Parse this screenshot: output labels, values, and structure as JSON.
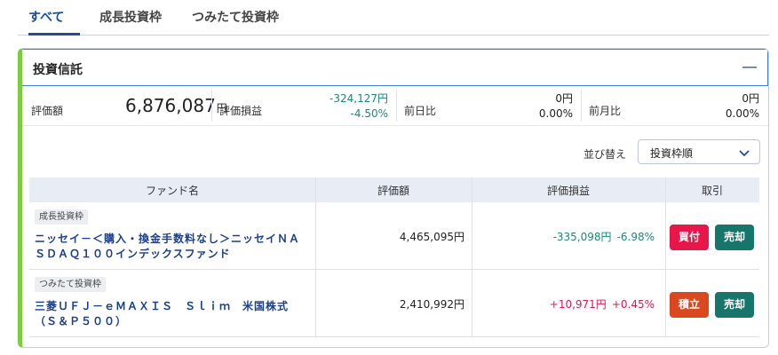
{
  "tabs": [
    {
      "label": "すべて",
      "active": true
    },
    {
      "label": "成長投資枠",
      "active": false
    },
    {
      "label": "つみたて投資枠",
      "active": false
    }
  ],
  "card": {
    "title": "投資信託",
    "collapse_symbol": "—",
    "summary": {
      "valuation_label": "評価額",
      "valuation_value": "6,876,087",
      "yen": "円",
      "pl_label": "評価損益",
      "pl_value": "-324,127円",
      "pl_pct": "-4.50%",
      "prev_day_label": "前日比",
      "prev_day_value": "0円",
      "prev_day_pct": "0.00%",
      "prev_month_label": "前月比",
      "prev_month_value": "0円",
      "prev_month_pct": "0.00%"
    },
    "sort": {
      "label": "並び替え",
      "value": "投資枠順"
    },
    "table": {
      "headers": [
        "ファンド名",
        "評価額",
        "評価損益",
        "取引"
      ],
      "rows": [
        {
          "badge": "成長投資枠",
          "fund": "ニッセイ－＜購入・換金手数料なし＞ニッセイＮＡＳＤＡＱ１００インデックスファンド",
          "amount": "4,465,095円",
          "pl_value": "-335,098円",
          "pl_pct": "-6.98%",
          "buttons": [
            "買付",
            "売却"
          ]
        },
        {
          "badge": "つみたて投資枠",
          "fund": "三菱ＵＦＪ－ｅＭＡＸＩＳ　Ｓｌｉｍ　米国株式（Ｓ＆Ｐ５００）",
          "amount": "2,410,992円",
          "pl_value": "+10,971円",
          "pl_pct": "+0.45%",
          "buttons": [
            "積立",
            "売却"
          ]
        }
      ]
    }
  },
  "colors": {
    "accent": "#1a4fa0",
    "left_border": "#7ccd3d",
    "negative": "#1a8a7a",
    "positive": "#e8174a",
    "buy": "#e8174a",
    "sell": "#16766b",
    "accumulate": "#d9481f"
  },
  "icons": {
    "collapse": "minus-icon",
    "sort_dropdown": "chevron-down-icon"
  }
}
